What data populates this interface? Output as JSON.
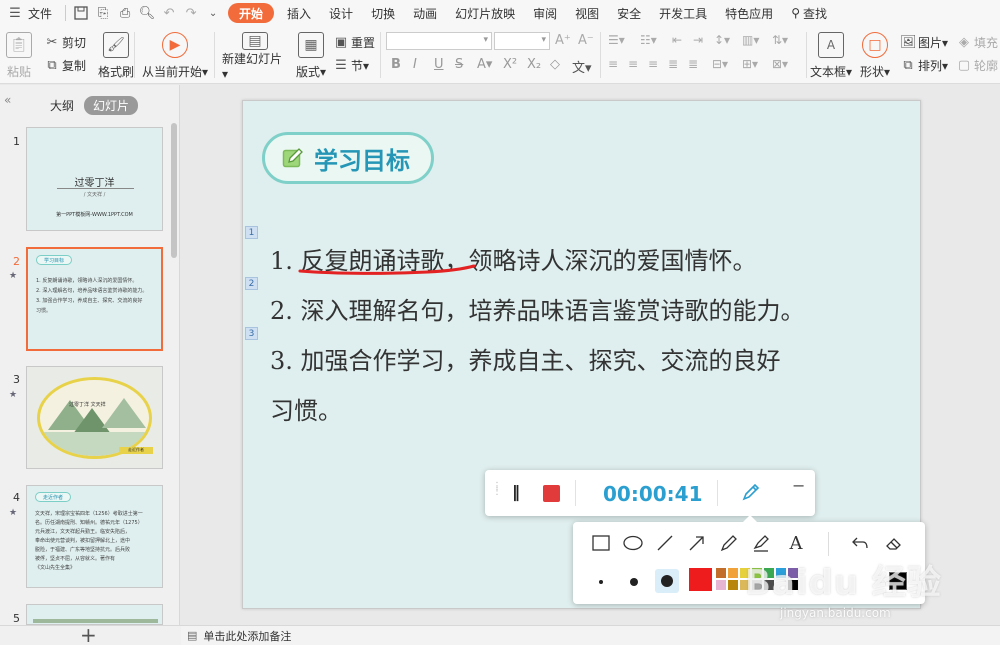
{
  "menubar": {
    "file": "文件",
    "tabs": [
      "开始",
      "插入",
      "设计",
      "切换",
      "动画",
      "幻灯片放映",
      "审阅",
      "视图",
      "安全",
      "开发工具",
      "特色应用"
    ],
    "search": "查找",
    "active_color": "#f26b3a"
  },
  "ribbon": {
    "paste": "粘贴",
    "cut": "剪切",
    "copy": "复制",
    "format_painter": "格式刷",
    "from_current": "从当前开始",
    "new_slide": "新建幻灯片",
    "layout": "版式",
    "reset": "重置",
    "section": "节",
    "textbox": "文本框",
    "shape": "形状",
    "picture": "图片",
    "arrange": "排列",
    "fill": "填充",
    "outline": "轮廓",
    "wen": "文"
  },
  "left_panel": {
    "tab_outline": "大纲",
    "tab_slides": "幻灯片",
    "slides": [
      {
        "num": "1",
        "title": "过零丁洋",
        "subtitle": "/ 文天祥 /",
        "url": "第一PPT模板网-WWW.1PPT.COM"
      },
      {
        "num": "2",
        "pill": "学习目标",
        "lines": [
          "1. 反复朗诵诗歌，领略诗人深沉的爱国情怀。",
          "2. 深入理解名句，培养品味语言鉴赏诗歌的能力。",
          "3. 加强合作学习，养成自主、探究、交流的良好",
          "习惯。"
        ]
      },
      {
        "num": "3",
        "title": "过零丁洋  文天祥",
        "tag": "走近作者"
      },
      {
        "num": "4",
        "pill": "走近作者",
        "lines": [
          "文天祥，宋理宗宝祐四年（1256）考取进士第一",
          "名。历任湖南提刑、知赣州。德祐元年（1275）",
          "元兵渡江，文天祥起兵勤王。临安失陷后，",
          "奉命出使元营谈判，被扣留押解北上，途中",
          "脱险，于福建、广东等地坚持抗元。后兵败",
          "被俘，坚贞不屈，从容就义。著作有",
          "《文山先生全集》"
        ]
      },
      {
        "num": "5"
      }
    ],
    "add": "+"
  },
  "slide": {
    "title": "学习目标",
    "markers": [
      "1",
      "2",
      "3"
    ],
    "lines": [
      {
        "num": "1.",
        "text": "反复朗诵诗歌，领略诗人深沉的爱国情怀。"
      },
      {
        "num": "2.",
        "text": "深入理解名句，培养品味语言鉴赏诗歌的能力。"
      },
      {
        "num": "3.",
        "text": "加强合作学习，养成自主、探究、交流的良好"
      },
      {
        "num": "",
        "text": "习惯。"
      }
    ],
    "bg_color": "#dfeeee",
    "title_color": "#2596b5",
    "underline_color": "#e32323"
  },
  "recorder": {
    "timer": "00:00:41",
    "pause_icon": "‖",
    "minimize": "−",
    "timer_color": "#2a9fd0"
  },
  "pen_panel": {
    "tools": [
      "rectangle-icon",
      "ellipse-icon",
      "line-icon",
      "arrow-icon",
      "pen-icon",
      "highlighter-icon",
      "text-icon",
      "undo-icon",
      "eraser-icon"
    ],
    "text_tool": "A",
    "selected_color": "#ee1c1c",
    "palette": [
      "#ee1c1c",
      "#c26d2a",
      "#f1a33a",
      "#e6d13c",
      "#8cc63f",
      "#3aa852",
      "#2b9fd9",
      "#7b5ea7",
      "#e6b5d3",
      "#b8860b",
      "#dbb85a",
      "#a6a6a6",
      "#4d4d4d",
      "#ffffff",
      "#000000",
      "#f5f5f5"
    ]
  },
  "notes": {
    "placeholder": "单击此处添加备注"
  },
  "watermark": {
    "logo": "Baidu 经验",
    "url": "jingyan.baidu.com"
  }
}
